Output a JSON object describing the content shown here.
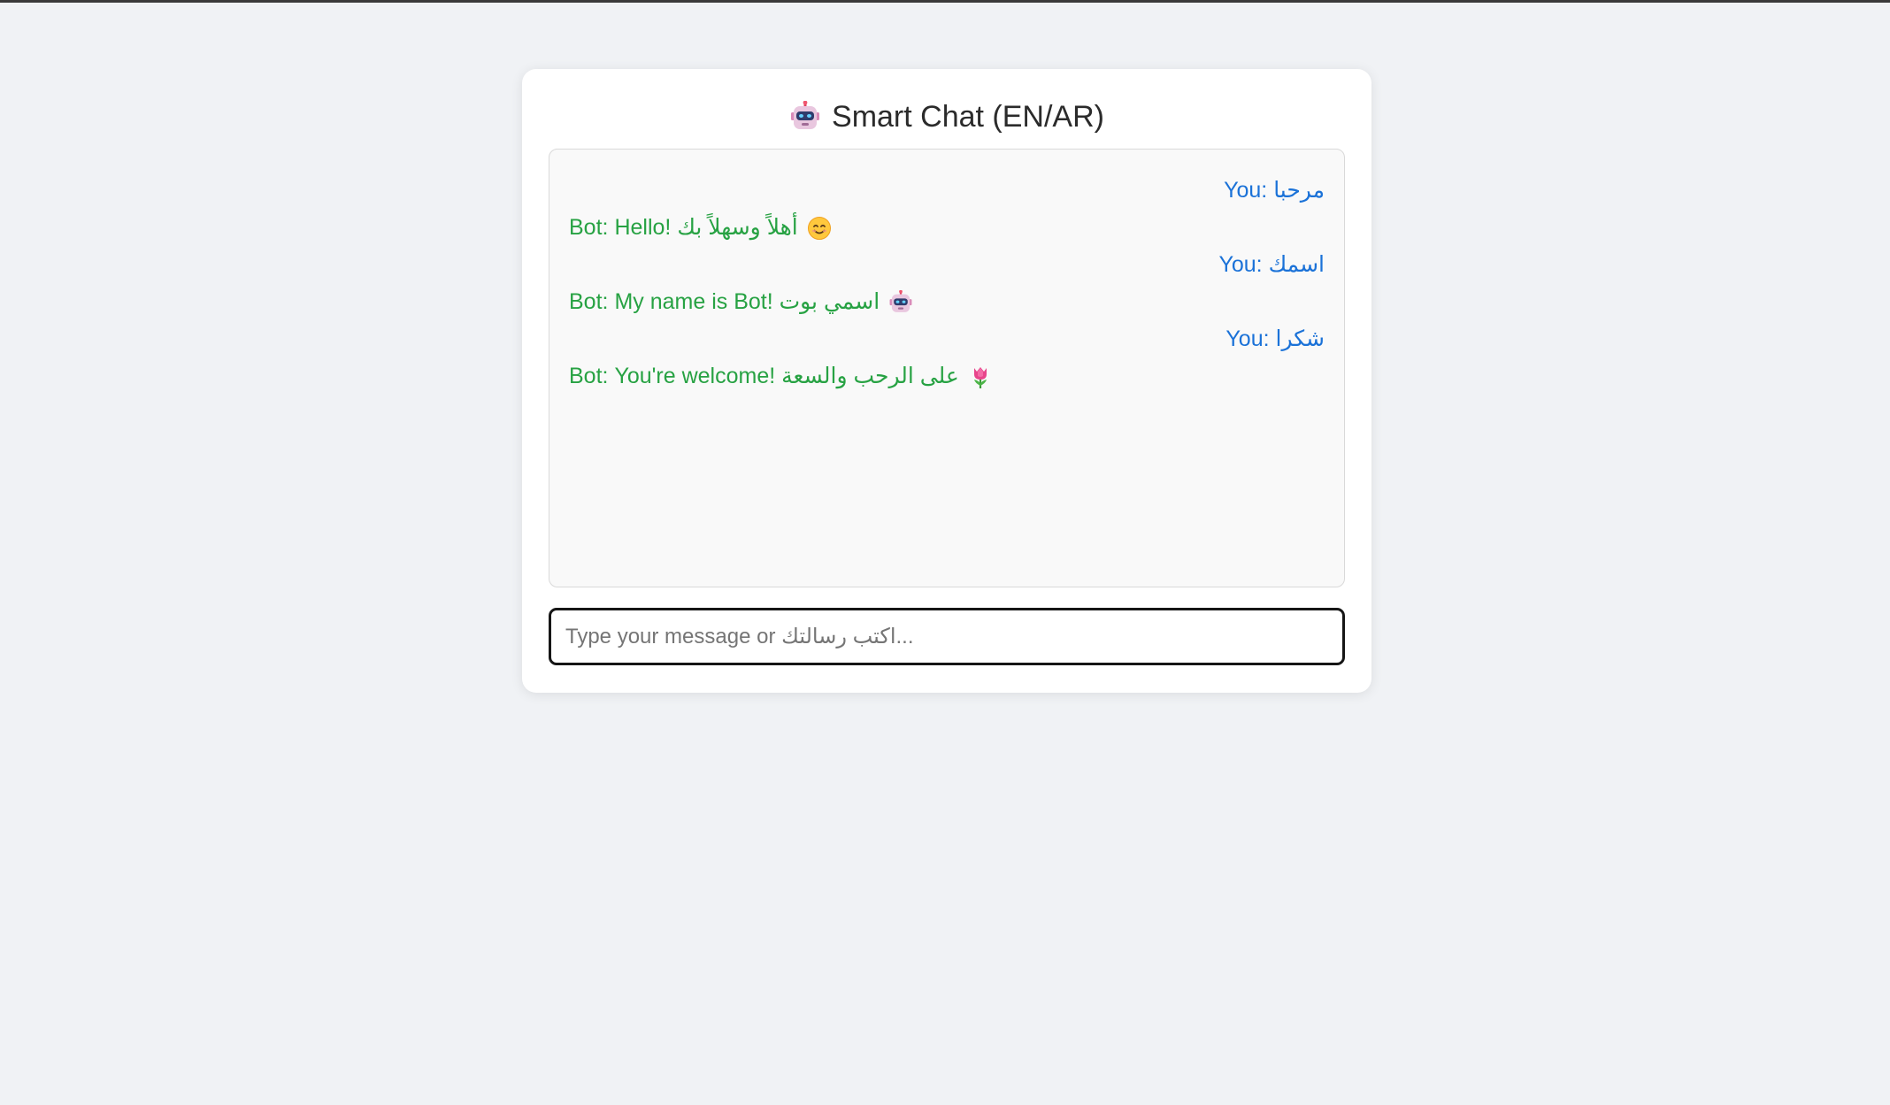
{
  "app": {
    "title": "Smart Chat (EN/AR)",
    "title_icon": "robot-icon"
  },
  "messages": [
    {
      "sender": "user",
      "prefix": "You:",
      "text": "مرحبا",
      "emoji": null
    },
    {
      "sender": "bot",
      "prefix": "Bot:",
      "text": "Hello! أهلاً وسهلاً بك",
      "emoji": "smiling-face-icon"
    },
    {
      "sender": "user",
      "prefix": "You:",
      "text": "اسمك",
      "emoji": null
    },
    {
      "sender": "bot",
      "prefix": "Bot:",
      "text": "My name is Bot! اسمي بوت",
      "emoji": "robot-icon"
    },
    {
      "sender": "user",
      "prefix": "You:",
      "text": "شكرا",
      "emoji": null
    },
    {
      "sender": "bot",
      "prefix": "Bot:",
      "text": "You're welcome! على الرحب والسعة",
      "emoji": "tulip-icon"
    }
  ],
  "input": {
    "placeholder": "Type your message or اكتب رسالتك...",
    "value": ""
  },
  "colors": {
    "background": "#f0f2f5",
    "card": "#ffffff",
    "user_text": "#1b72d8",
    "bot_text": "#27a243",
    "chat_box_bg": "#f9f9f9"
  }
}
